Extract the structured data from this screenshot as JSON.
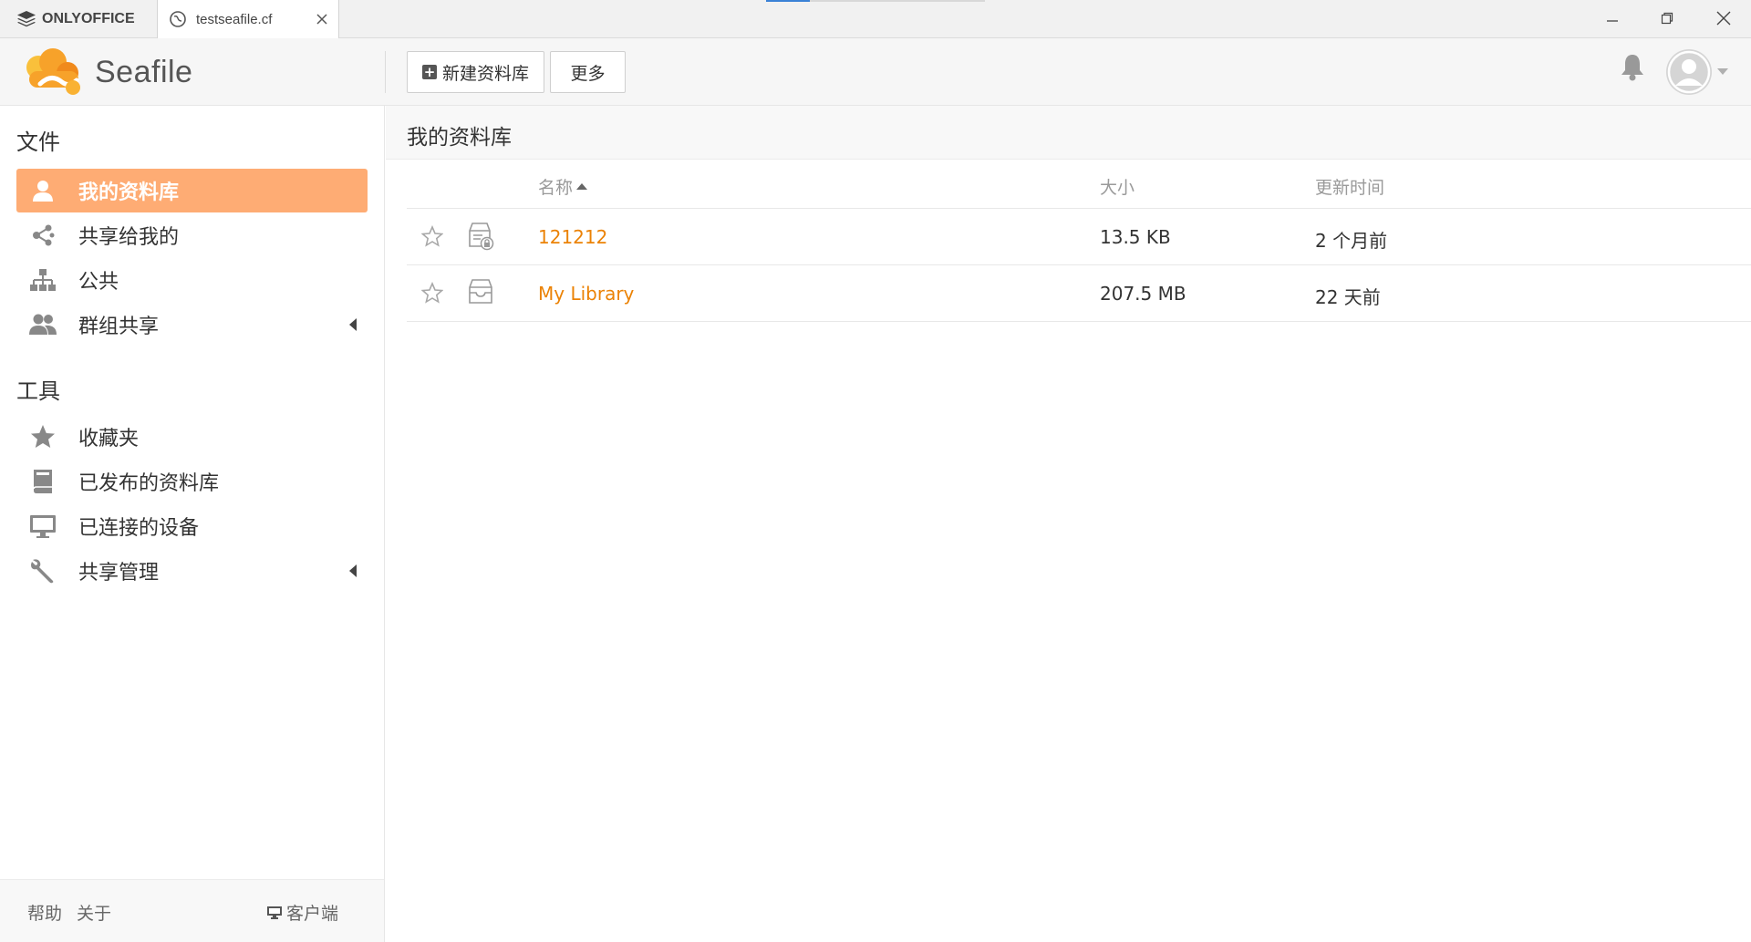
{
  "titlebar": {
    "app_name": "ONLYOFFICE",
    "tab_title": "testseafile.cf",
    "loading_progress": 0.2
  },
  "header": {
    "logo_text": "Seafile",
    "new_library_label": "新建资料库",
    "more_label": "更多"
  },
  "sidebar": {
    "files_heading": "文件",
    "files_items": [
      {
        "label": "我的资料库",
        "icon": "user-icon",
        "active": true
      },
      {
        "label": "共享给我的",
        "icon": "share-icon"
      },
      {
        "label": "公共",
        "icon": "sitemap-icon"
      },
      {
        "label": "群组共享",
        "icon": "group-icon",
        "expandable": true
      }
    ],
    "tools_heading": "工具",
    "tools_items": [
      {
        "label": "收藏夹",
        "icon": "star-icon"
      },
      {
        "label": "已发布的资料库",
        "icon": "book-icon"
      },
      {
        "label": "已连接的设备",
        "icon": "monitor-icon"
      },
      {
        "label": "共享管理",
        "icon": "wrench-icon",
        "expandable": true
      }
    ],
    "footer": {
      "help": "帮助",
      "about": "关于",
      "client": "客户端"
    }
  },
  "main": {
    "title": "我的资料库",
    "columns": {
      "name": "名称",
      "size": "大小",
      "updated": "更新时间"
    },
    "rows": [
      {
        "name": "121212",
        "size": "13.5 KB",
        "updated": "2 个月前",
        "icon": "encrypted-library-icon"
      },
      {
        "name": "My Library",
        "size": "207.5 MB",
        "updated": "22 天前",
        "icon": "library-icon"
      }
    ]
  },
  "colors": {
    "accent": "#feac74",
    "link": "#eb8205",
    "logo_orange": "#f7a22a"
  }
}
